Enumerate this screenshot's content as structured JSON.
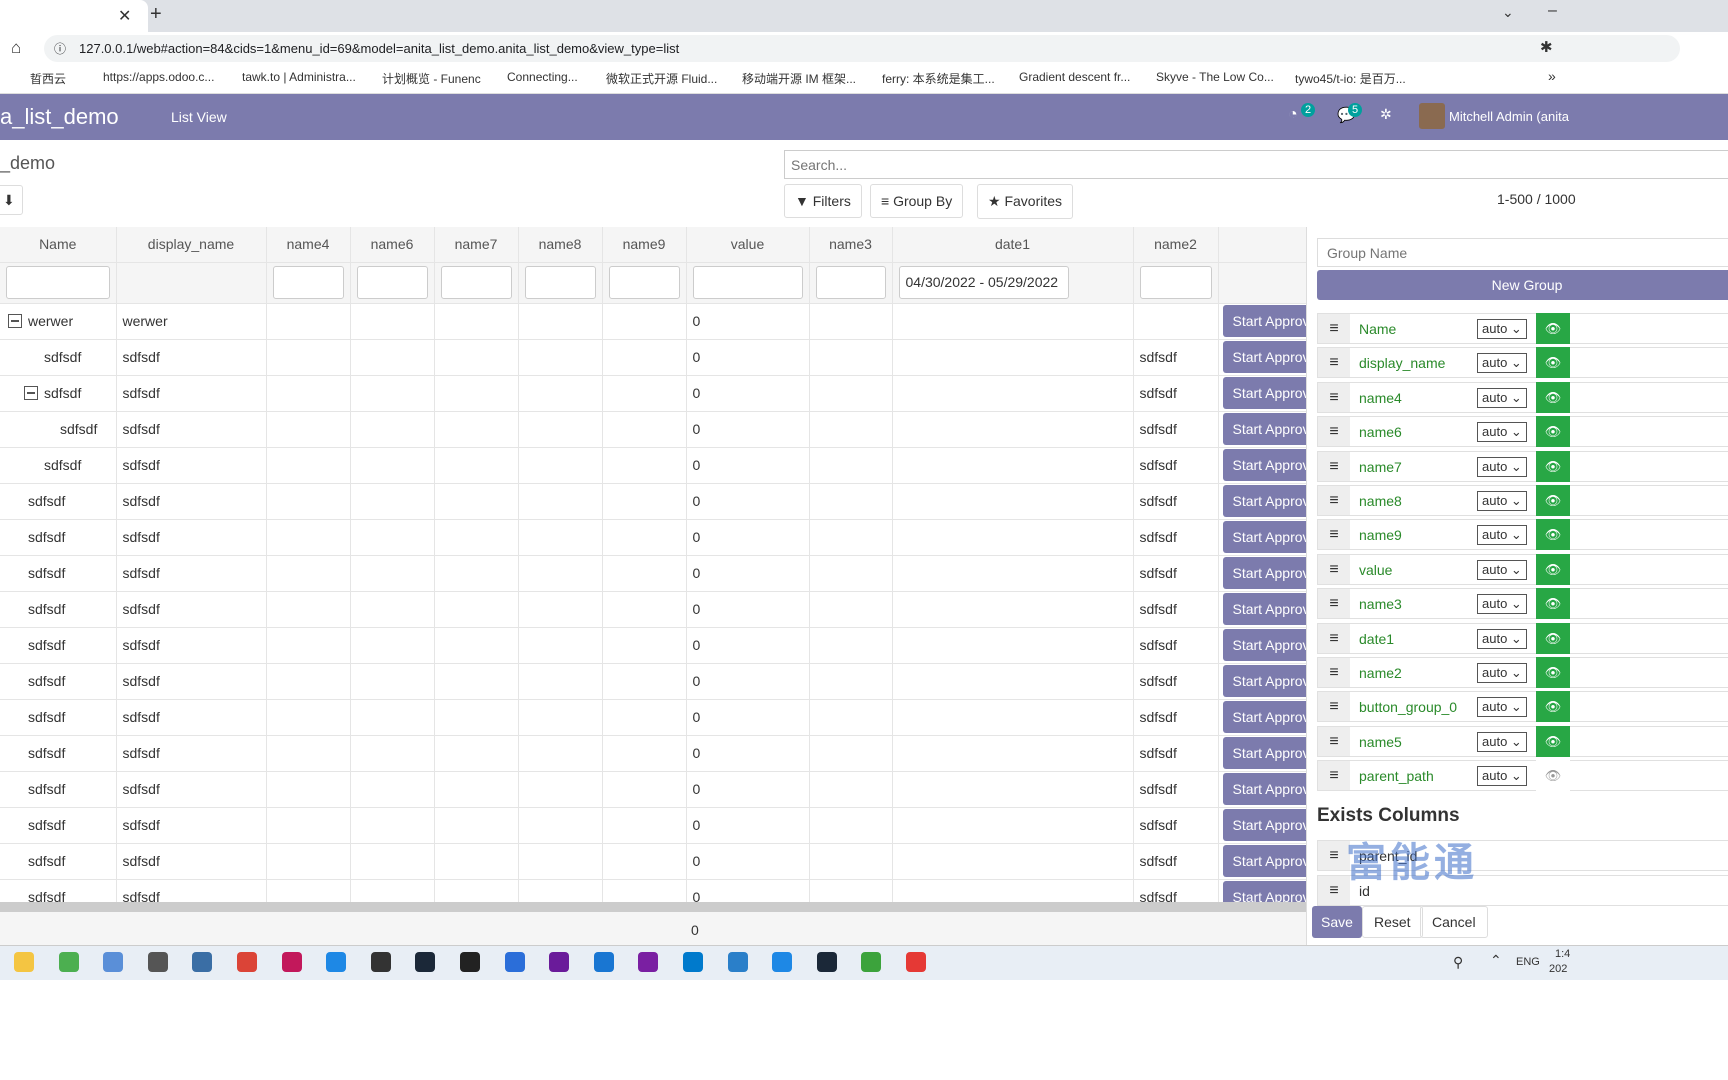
{
  "browser": {
    "url": "127.0.0.1/web#action=84&cids=1&menu_id=69&model=anita_list_demo.anita_list_demo&view_type=list",
    "bookmarks": [
      "晢西云",
      "https://apps.odoo.c...",
      "tawk.to | Administra...",
      "计划概览 - Funenc",
      "Connecting...",
      "微软正式开源 Fluid...",
      "移动端开源 IM 框架...",
      "ferry: 本系统是集工...",
      "Gradient descent fr...",
      "Skyve - The Low Co...",
      "tywo45/t-io: 是百万..."
    ]
  },
  "nav": {
    "app": "a_list_demo",
    "menu": "List View",
    "activity_count": "2",
    "message_count": "5",
    "user": "Mitchell Admin (anita"
  },
  "control": {
    "breadcrumb": "_demo",
    "search_placeholder": "Search...",
    "filters": "Filters",
    "group_by": "Group By",
    "favorites": "Favorites",
    "pager": "1-500 / 1000"
  },
  "table": {
    "columns": [
      "Name",
      "display_name",
      "name4",
      "name6",
      "name7",
      "name8",
      "name9",
      "value",
      "name3",
      "date1",
      "name2",
      ""
    ],
    "date_filter": "04/30/2022 - 05/29/2022",
    "button_label": "Start Approv",
    "rows": [
      {
        "name": "werwer",
        "display": "werwer",
        "value": "0",
        "name2": "",
        "level": 0,
        "toggle": true
      },
      {
        "name": "sdfsdf",
        "display": "sdfsdf",
        "value": "0",
        "name2": "sdfsdf",
        "level": 1,
        "toggle": false
      },
      {
        "name": "sdfsdf",
        "display": "sdfsdf",
        "value": "0",
        "name2": "sdfsdf",
        "level": 1,
        "toggle": true
      },
      {
        "name": "sdfsdf",
        "display": "sdfsdf",
        "value": "0",
        "name2": "sdfsdf",
        "level": 2,
        "toggle": false
      },
      {
        "name": "sdfsdf",
        "display": "sdfsdf",
        "value": "0",
        "name2": "sdfsdf",
        "level": 1,
        "toggle": false
      },
      {
        "name": "sdfsdf",
        "display": "sdfsdf",
        "value": "0",
        "name2": "sdfsdf",
        "level": 0,
        "toggle": false
      },
      {
        "name": "sdfsdf",
        "display": "sdfsdf",
        "value": "0",
        "name2": "sdfsdf",
        "level": 0,
        "toggle": false
      },
      {
        "name": "sdfsdf",
        "display": "sdfsdf",
        "value": "0",
        "name2": "sdfsdf",
        "level": 0,
        "toggle": false
      },
      {
        "name": "sdfsdf",
        "display": "sdfsdf",
        "value": "0",
        "name2": "sdfsdf",
        "level": 0,
        "toggle": false
      },
      {
        "name": "sdfsdf",
        "display": "sdfsdf",
        "value": "0",
        "name2": "sdfsdf",
        "level": 0,
        "toggle": false
      },
      {
        "name": "sdfsdf",
        "display": "sdfsdf",
        "value": "0",
        "name2": "sdfsdf",
        "level": 0,
        "toggle": false
      },
      {
        "name": "sdfsdf",
        "display": "sdfsdf",
        "value": "0",
        "name2": "sdfsdf",
        "level": 0,
        "toggle": false
      },
      {
        "name": "sdfsdf",
        "display": "sdfsdf",
        "value": "0",
        "name2": "sdfsdf",
        "level": 0,
        "toggle": false
      },
      {
        "name": "sdfsdf",
        "display": "sdfsdf",
        "value": "0",
        "name2": "sdfsdf",
        "level": 0,
        "toggle": false
      },
      {
        "name": "sdfsdf",
        "display": "sdfsdf",
        "value": "0",
        "name2": "sdfsdf",
        "level": 0,
        "toggle": false
      },
      {
        "name": "sdfsdf",
        "display": "sdfsdf",
        "value": "0",
        "name2": "sdfsdf",
        "level": 0,
        "toggle": false
      },
      {
        "name": "sdfsdf",
        "display": "sdfsdf",
        "value": "0",
        "name2": "sdfsdf",
        "level": 0,
        "toggle": false
      }
    ],
    "footer_value": "0"
  },
  "panel": {
    "group_placeholder": "Group Name",
    "new_group": "New Group",
    "columns": [
      {
        "label": "Name",
        "width": "auto",
        "visible": true
      },
      {
        "label": "display_name",
        "width": "auto",
        "visible": true
      },
      {
        "label": "name4",
        "width": "auto",
        "visible": true
      },
      {
        "label": "name6",
        "width": "auto",
        "visible": true
      },
      {
        "label": "name7",
        "width": "auto",
        "visible": true
      },
      {
        "label": "name8",
        "width": "auto",
        "visible": true
      },
      {
        "label": "name9",
        "width": "auto",
        "visible": true
      },
      {
        "label": "value",
        "width": "auto",
        "visible": true
      },
      {
        "label": "name3",
        "width": "auto",
        "visible": true
      },
      {
        "label": "date1",
        "width": "auto",
        "visible": true
      },
      {
        "label": "name2",
        "width": "auto",
        "visible": true
      },
      {
        "label": "button_group_0",
        "width": "auto",
        "visible": true
      },
      {
        "label": "name5",
        "width": "auto",
        "visible": true
      },
      {
        "label": "parent_path",
        "width": "auto",
        "visible": false
      }
    ],
    "exists_title": "Exists Columns",
    "exists": [
      "parent_id",
      "id"
    ],
    "save": "Save",
    "reset": "Reset",
    "cancel": "Cancel"
  },
  "taskbar": {
    "lang": "ENG",
    "time": "1:4",
    "date": "202"
  },
  "colors": {
    "nav": "#7c7bad",
    "visible": "#28a745",
    "label": "#2a8a2a"
  }
}
